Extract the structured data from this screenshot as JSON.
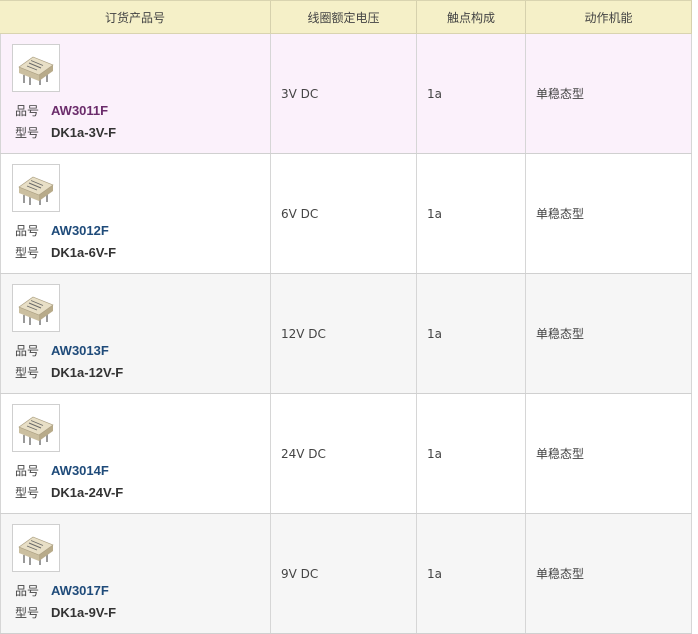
{
  "header": {
    "col_product": "订货产品号",
    "col_voltage": "线圈额定电压",
    "col_contact": "触点构成",
    "col_function": "动作机能"
  },
  "labels": {
    "part_no": "品号",
    "model": "型号"
  },
  "colors": {
    "header_bg": "#f5f0c8",
    "link": "#1f4b7a",
    "visited_link": "#6b2c6b",
    "highlight_row": "#fbf1fb"
  },
  "rows": [
    {
      "part_no": "AW3011F",
      "model": "DK1a-3V-F",
      "voltage": "3V DC",
      "contact": "1a",
      "function": "单稳态型",
      "image": "relay-icon"
    },
    {
      "part_no": "AW3012F",
      "model": "DK1a-6V-F",
      "voltage": "6V DC",
      "contact": "1a",
      "function": "单稳态型",
      "image": "relay-icon"
    },
    {
      "part_no": "AW3013F",
      "model": "DK1a-12V-F",
      "voltage": "12V DC",
      "contact": "1a",
      "function": "单稳态型",
      "image": "relay-icon"
    },
    {
      "part_no": "AW3014F",
      "model": "DK1a-24V-F",
      "voltage": "24V DC",
      "contact": "1a",
      "function": "单稳态型",
      "image": "relay-icon"
    },
    {
      "part_no": "AW3017F",
      "model": "DK1a-9V-F",
      "voltage": "9V DC",
      "contact": "1a",
      "function": "单稳态型",
      "image": "relay-icon"
    }
  ]
}
